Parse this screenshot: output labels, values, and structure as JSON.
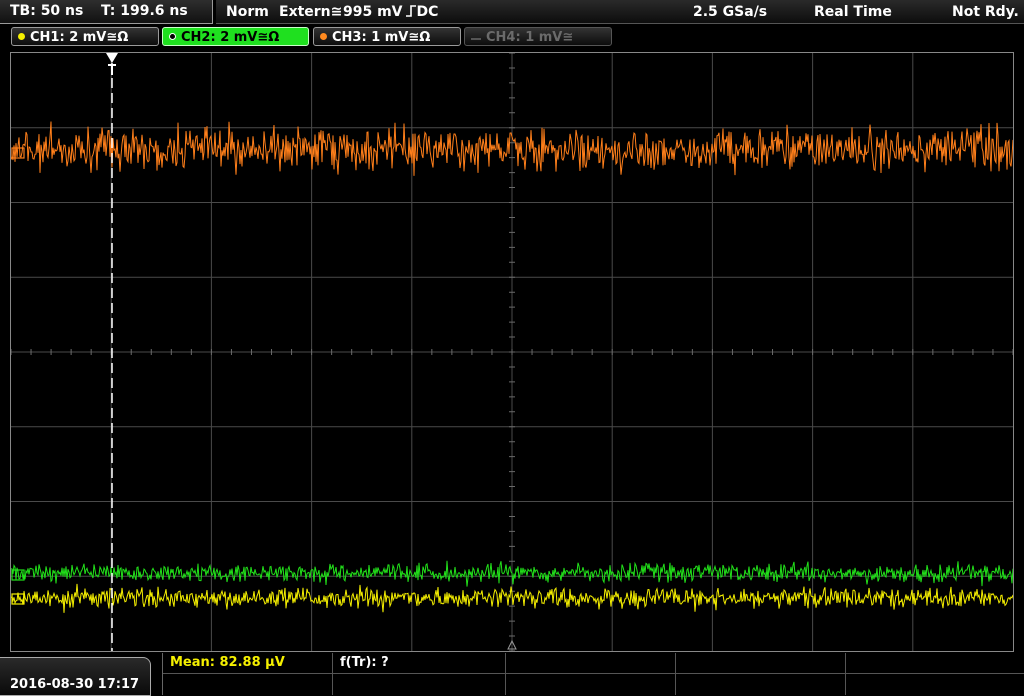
{
  "topbar": {
    "timebase": "TB: 50 ns",
    "trigger_time": "T: 199.6 ns",
    "mode": "Norm",
    "trigger_source": "Extern",
    "coupling_icon": "≅",
    "trigger_level": "995 mV",
    "slope_icon": "rising-edge-icon",
    "trigger_coupling": "DC",
    "sample_rate": "2.5 GSa/s",
    "acq_mode": "Real Time",
    "status": "Not Rdy."
  },
  "channels": [
    {
      "label": "CH1: 2 mV≅Ω",
      "color": "#f5f000",
      "state": "on"
    },
    {
      "label": "CH2: 2 mV≅Ω",
      "color": "#1fe01f",
      "state": "active"
    },
    {
      "label": "CH3: 1 mV≅Ω",
      "color": "#ff8a1f",
      "state": "on"
    },
    {
      "label": "CH4: 1 mV≅",
      "color": "#6b6b6b",
      "state": "off"
    }
  ],
  "traces": {
    "ch3_color": "#ff7f1a",
    "ch2_color": "#22e21a",
    "ch1_color": "#f5ef00",
    "grid_color": "#4a4a4a"
  },
  "bottom": {
    "datetime": "2016-08-30 17:17",
    "measurement_1": "Mean: 82.88 μV",
    "measurement_2": "f(Tr): ?"
  }
}
